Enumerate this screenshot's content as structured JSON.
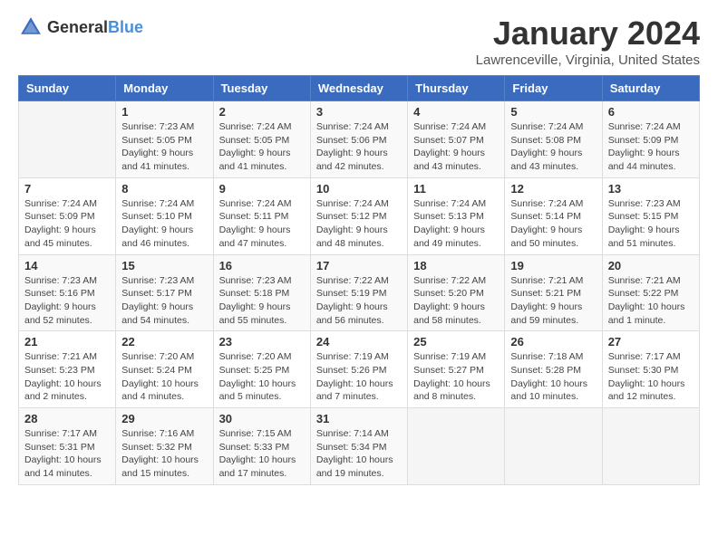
{
  "header": {
    "logo_general": "General",
    "logo_blue": "Blue",
    "month": "January 2024",
    "location": "Lawrenceville, Virginia, United States"
  },
  "weekdays": [
    "Sunday",
    "Monday",
    "Tuesday",
    "Wednesday",
    "Thursday",
    "Friday",
    "Saturday"
  ],
  "weeks": [
    [
      {
        "day": "",
        "sunrise": "",
        "sunset": "",
        "daylight": ""
      },
      {
        "day": "1",
        "sunrise": "Sunrise: 7:23 AM",
        "sunset": "Sunset: 5:05 PM",
        "daylight": "Daylight: 9 hours and 41 minutes."
      },
      {
        "day": "2",
        "sunrise": "Sunrise: 7:24 AM",
        "sunset": "Sunset: 5:05 PM",
        "daylight": "Daylight: 9 hours and 41 minutes."
      },
      {
        "day": "3",
        "sunrise": "Sunrise: 7:24 AM",
        "sunset": "Sunset: 5:06 PM",
        "daylight": "Daylight: 9 hours and 42 minutes."
      },
      {
        "day": "4",
        "sunrise": "Sunrise: 7:24 AM",
        "sunset": "Sunset: 5:07 PM",
        "daylight": "Daylight: 9 hours and 43 minutes."
      },
      {
        "day": "5",
        "sunrise": "Sunrise: 7:24 AM",
        "sunset": "Sunset: 5:08 PM",
        "daylight": "Daylight: 9 hours and 43 minutes."
      },
      {
        "day": "6",
        "sunrise": "Sunrise: 7:24 AM",
        "sunset": "Sunset: 5:09 PM",
        "daylight": "Daylight: 9 hours and 44 minutes."
      }
    ],
    [
      {
        "day": "7",
        "sunrise": "Sunrise: 7:24 AM",
        "sunset": "Sunset: 5:09 PM",
        "daylight": "Daylight: 9 hours and 45 minutes."
      },
      {
        "day": "8",
        "sunrise": "Sunrise: 7:24 AM",
        "sunset": "Sunset: 5:10 PM",
        "daylight": "Daylight: 9 hours and 46 minutes."
      },
      {
        "day": "9",
        "sunrise": "Sunrise: 7:24 AM",
        "sunset": "Sunset: 5:11 PM",
        "daylight": "Daylight: 9 hours and 47 minutes."
      },
      {
        "day": "10",
        "sunrise": "Sunrise: 7:24 AM",
        "sunset": "Sunset: 5:12 PM",
        "daylight": "Daylight: 9 hours and 48 minutes."
      },
      {
        "day": "11",
        "sunrise": "Sunrise: 7:24 AM",
        "sunset": "Sunset: 5:13 PM",
        "daylight": "Daylight: 9 hours and 49 minutes."
      },
      {
        "day": "12",
        "sunrise": "Sunrise: 7:24 AM",
        "sunset": "Sunset: 5:14 PM",
        "daylight": "Daylight: 9 hours and 50 minutes."
      },
      {
        "day": "13",
        "sunrise": "Sunrise: 7:23 AM",
        "sunset": "Sunset: 5:15 PM",
        "daylight": "Daylight: 9 hours and 51 minutes."
      }
    ],
    [
      {
        "day": "14",
        "sunrise": "Sunrise: 7:23 AM",
        "sunset": "Sunset: 5:16 PM",
        "daylight": "Daylight: 9 hours and 52 minutes."
      },
      {
        "day": "15",
        "sunrise": "Sunrise: 7:23 AM",
        "sunset": "Sunset: 5:17 PM",
        "daylight": "Daylight: 9 hours and 54 minutes."
      },
      {
        "day": "16",
        "sunrise": "Sunrise: 7:23 AM",
        "sunset": "Sunset: 5:18 PM",
        "daylight": "Daylight: 9 hours and 55 minutes."
      },
      {
        "day": "17",
        "sunrise": "Sunrise: 7:22 AM",
        "sunset": "Sunset: 5:19 PM",
        "daylight": "Daylight: 9 hours and 56 minutes."
      },
      {
        "day": "18",
        "sunrise": "Sunrise: 7:22 AM",
        "sunset": "Sunset: 5:20 PM",
        "daylight": "Daylight: 9 hours and 58 minutes."
      },
      {
        "day": "19",
        "sunrise": "Sunrise: 7:21 AM",
        "sunset": "Sunset: 5:21 PM",
        "daylight": "Daylight: 9 hours and 59 minutes."
      },
      {
        "day": "20",
        "sunrise": "Sunrise: 7:21 AM",
        "sunset": "Sunset: 5:22 PM",
        "daylight": "Daylight: 10 hours and 1 minute."
      }
    ],
    [
      {
        "day": "21",
        "sunrise": "Sunrise: 7:21 AM",
        "sunset": "Sunset: 5:23 PM",
        "daylight": "Daylight: 10 hours and 2 minutes."
      },
      {
        "day": "22",
        "sunrise": "Sunrise: 7:20 AM",
        "sunset": "Sunset: 5:24 PM",
        "daylight": "Daylight: 10 hours and 4 minutes."
      },
      {
        "day": "23",
        "sunrise": "Sunrise: 7:20 AM",
        "sunset": "Sunset: 5:25 PM",
        "daylight": "Daylight: 10 hours and 5 minutes."
      },
      {
        "day": "24",
        "sunrise": "Sunrise: 7:19 AM",
        "sunset": "Sunset: 5:26 PM",
        "daylight": "Daylight: 10 hours and 7 minutes."
      },
      {
        "day": "25",
        "sunrise": "Sunrise: 7:19 AM",
        "sunset": "Sunset: 5:27 PM",
        "daylight": "Daylight: 10 hours and 8 minutes."
      },
      {
        "day": "26",
        "sunrise": "Sunrise: 7:18 AM",
        "sunset": "Sunset: 5:28 PM",
        "daylight": "Daylight: 10 hours and 10 minutes."
      },
      {
        "day": "27",
        "sunrise": "Sunrise: 7:17 AM",
        "sunset": "Sunset: 5:30 PM",
        "daylight": "Daylight: 10 hours and 12 minutes."
      }
    ],
    [
      {
        "day": "28",
        "sunrise": "Sunrise: 7:17 AM",
        "sunset": "Sunset: 5:31 PM",
        "daylight": "Daylight: 10 hours and 14 minutes."
      },
      {
        "day": "29",
        "sunrise": "Sunrise: 7:16 AM",
        "sunset": "Sunset: 5:32 PM",
        "daylight": "Daylight: 10 hours and 15 minutes."
      },
      {
        "day": "30",
        "sunrise": "Sunrise: 7:15 AM",
        "sunset": "Sunset: 5:33 PM",
        "daylight": "Daylight: 10 hours and 17 minutes."
      },
      {
        "day": "31",
        "sunrise": "Sunrise: 7:14 AM",
        "sunset": "Sunset: 5:34 PM",
        "daylight": "Daylight: 10 hours and 19 minutes."
      },
      {
        "day": "",
        "sunrise": "",
        "sunset": "",
        "daylight": ""
      },
      {
        "day": "",
        "sunrise": "",
        "sunset": "",
        "daylight": ""
      },
      {
        "day": "",
        "sunrise": "",
        "sunset": "",
        "daylight": ""
      }
    ]
  ]
}
